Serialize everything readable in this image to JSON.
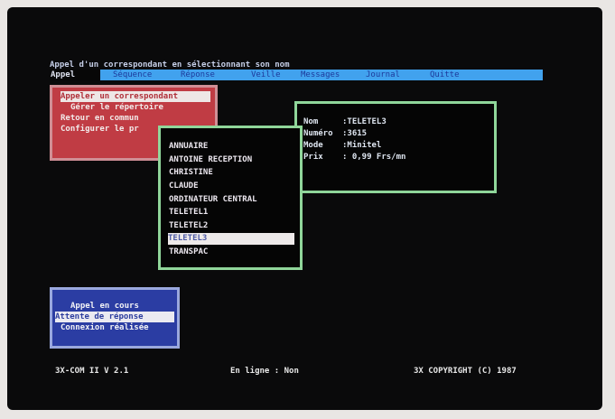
{
  "hint": "Appel d'un correspondant en sélectionnant son nom",
  "menu": {
    "active": "Appel",
    "items": [
      "Séquence",
      "Réponse",
      "Veille",
      "Messages",
      "Journal",
      "Quitte"
    ]
  },
  "call_menu": {
    "items": [
      "Appeler un correspondant",
      "Gérer le répertoire",
      "Retour en commun",
      "Configurer le pr"
    ]
  },
  "directory": {
    "entries": [
      "ANNUAIRE",
      "ANTOINE RECEPTION",
      "CHRISTINE",
      "CLAUDE",
      "ORDINATEUR CENTRAL",
      "TELETEL1",
      "TELETEL2",
      "TELETEL3",
      "TRANSPAC"
    ],
    "selected": "TELETEL3"
  },
  "details": {
    "nom_label": "Nom",
    "nom": ":TELETEL3",
    "numero_label": "Numéro",
    "numero": ":3615",
    "mode_label": "Mode",
    "mode": ":Minitel",
    "prix_label": "Prix",
    "prix": ": 0,99 Frs/mn"
  },
  "call_status": {
    "items": [
      "Appel en cours",
      "Attente de réponse",
      "Connexion réalisée"
    ],
    "selected": "Attente de réponse"
  },
  "status_bar": {
    "version": "3X-COM II V 2.1",
    "online": "En ligne : Non",
    "copyright": "3X COPYRIGHT (C) 1987"
  },
  "colors": {
    "menubar": "#41a2ee",
    "red_panel": "#c03c44",
    "blue_panel": "#2b3da3",
    "green_border": "#90d69a"
  }
}
